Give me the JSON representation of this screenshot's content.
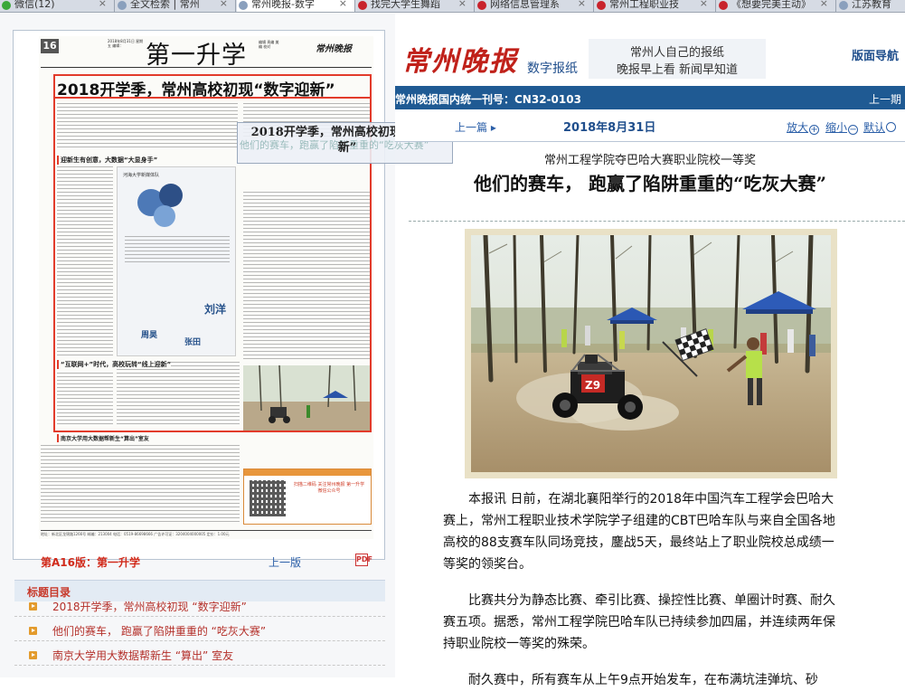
{
  "browser": {
    "tabs": [
      {
        "label": "微信(12)",
        "color": "#3aa83a"
      },
      {
        "label": "全文检索 | 常州",
        "color": "#8aa0bd"
      },
      {
        "label": "常州晚报-数字",
        "color": "#8aa0bd"
      },
      {
        "label": "找完大学生舞蹈",
        "color": "#c8232c"
      },
      {
        "label": "网络信息管理系",
        "color": "#c8232c"
      },
      {
        "label": "常州工程职业技",
        "color": "#c8232c"
      },
      {
        "label": "《想要完美主动》",
        "color": "#c8232c"
      },
      {
        "label": "江苏教育",
        "color": "#8aa0bd"
      }
    ],
    "close_glyph": "×"
  },
  "newspaper_page": {
    "page_no": "16",
    "date_line": "2018年8月31日 星期五 编辑：",
    "section_title": "第一升学",
    "editors": "编辑 责编 美编 校对",
    "brand": "常州晚报",
    "headline": "2018开学季，常州高校初现“数字迎新”",
    "sub_heads": [
      "迎新生有创意，大数据“大显身手”",
      "“互联网+”时代，高校玩转“线上迎新”"
    ],
    "infographic_title": "河海大学新媒体队",
    "infographic_words": [
      "周昊",
      "刘洋",
      "张田"
    ],
    "footnote_head": "南京大学用大数据帮新生“算出”室友",
    "ad_lines": "扫描二维码 关注常州晚报 第一升学 微信公众号",
    "footer": "地址：新北区龙锦路1266号 邮编：213004 电话：0519-86698666 广告许可证：3204004000005 定价：1.00元"
  },
  "tooltip": {
    "text": "2018开学季，常州高校初现“数字迎新”",
    "ghost": "他们的赛车，跑赢了陷阱重重的“吃灰大赛”"
  },
  "left_footer": {
    "edition": "第A16版：第一升学",
    "prev_page": "上一版",
    "pdf": "PDF"
  },
  "toc": {
    "heading": "标题目录",
    "items": [
      "2018开学季，常州高校初现 “数字迎新”",
      "他们的赛车，  跑赢了陷阱重重的 “吃灰大赛”",
      "南京大学用大数据帮新生 “算出” 室友"
    ]
  },
  "masthead": {
    "logo": "常州晚报",
    "digital": "数字报纸",
    "slogan1": "常州人自己的报纸",
    "slogan2": "晚报早上看 新闻早知道",
    "layout_nav": "版面导航"
  },
  "issn_bar": {
    "text": "常州晚报国内统一刊号：CN32-0103",
    "prev_issue": "上一期"
  },
  "article_bar": {
    "prev_article": "上一篇",
    "date": "2018年8月31日",
    "zoom_in": "放大",
    "zoom_out": "缩小",
    "default": "默认"
  },
  "article": {
    "kicker": "常州工程学院夺巴哈大赛职业院校一等奖",
    "title": "他们的赛车，  跑赢了陷阱重重的“吃灰大赛”",
    "paragraphs": [
      "本报讯 日前，在湖北襄阳举行的2018年中国汽车工程学会巴哈大赛上，常州工程职业技术学院学子组建的CBT巴哈车队与来自全国各地高校的88支赛车队同场竞技，鏖战5天，最终站上了职业院校总成绩一等奖的领奖台。",
      "比赛共分为静态比赛、牵引比赛、操控性比赛、单圈计时赛、耐久赛五项。据悉，常州工程学院巴哈车队已持续参加四届，并连续两年保持职业院校一等奖的殊荣。",
      "耐久赛中，所有赛车从上午9点开始发车，在布满坑洼弹坑、砂"
    ],
    "car_number": "Z9"
  }
}
